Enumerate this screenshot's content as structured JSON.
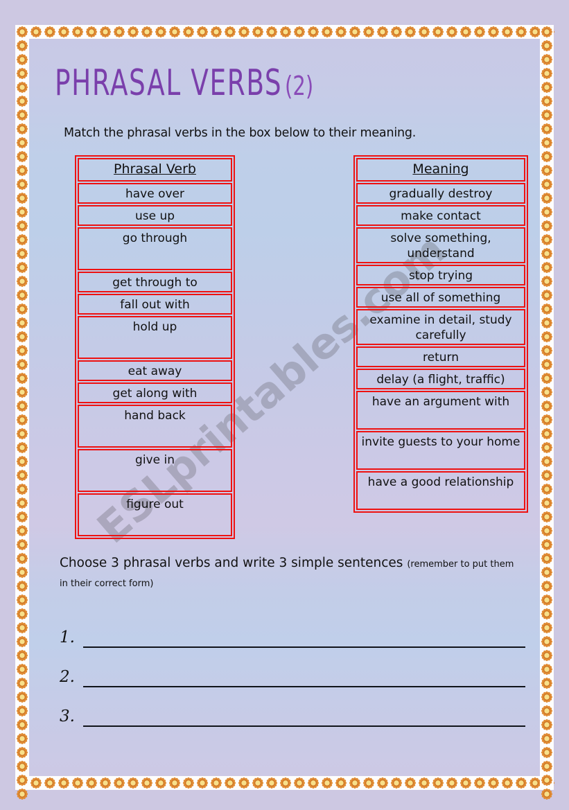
{
  "title": {
    "main": "PHRASAL VERBS",
    "suffix": "(2)",
    "color": "#7a3fab"
  },
  "instructions": {
    "top": "Match the phrasal verbs in the box below to their meaning.",
    "bottom_main": "Choose 3 phrasal verbs and write 3 simple sentences",
    "bottom_small": "(remember to put them in their correct form)"
  },
  "watermark": "ESLprintables.com",
  "tables": {
    "verbs": {
      "header": "Phrasal Verb",
      "rows": [
        "have over",
        "use up",
        "go through",
        "get through to",
        "fall out with",
        "hold up",
        "eat away",
        "get along with",
        "hand back",
        "give in",
        "figure out"
      ]
    },
    "meanings": {
      "header": "Meaning",
      "rows": [
        "gradually destroy",
        "make contact",
        "solve something, understand",
        "stop trying",
        "use all of something",
        "examine in detail, study carefully",
        "return",
        "delay (a flight, traffic)",
        "have an argument with",
        "invite guests to your home",
        "have a good relationship"
      ]
    }
  },
  "answers": {
    "numbers": [
      "1.",
      "2.",
      "3."
    ]
  },
  "colors": {
    "table_border": "#ee1111",
    "text": "#111111",
    "flower_petal": "#e08b33",
    "flower_center": "#f8e08a"
  }
}
